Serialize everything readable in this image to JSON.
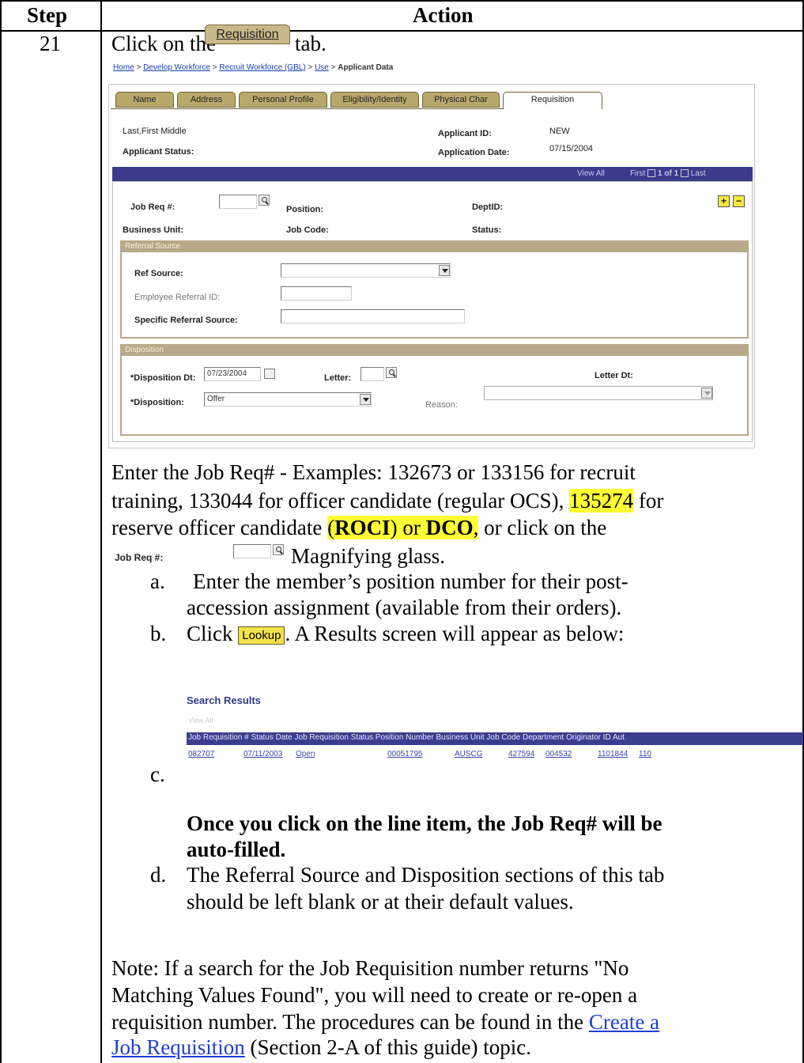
{
  "table": {
    "col_step": "Step",
    "col_action": "Action",
    "step_number": "21"
  },
  "intro": {
    "prefix": "Click on the",
    "tab_button": "Requisition",
    "suffix": "tab."
  },
  "screen": {
    "breadcrumb": [
      "Home",
      "Develop Workforce",
      "Recruit Workforce (GBL)",
      "Use",
      "Applicant Data"
    ],
    "tabs": [
      "Name",
      "Address",
      "Personal Profile",
      "Eligibility/Identity",
      "Physical Char",
      "Requisition"
    ],
    "name_line": "Last,First Middle",
    "applicant_status_label": "Applicant Status:",
    "applicant_id_label": "Applicant ID:",
    "applicant_id_value": "NEW",
    "application_date_label": "Application Date:",
    "application_date_value": "07/15/2004",
    "nav": {
      "view_all": "View All",
      "first": "First",
      "count": "1 of 1",
      "last": "Last"
    },
    "job_req_label": "Job Req #:",
    "position_label": "Position:",
    "deptid_label": "DeptID:",
    "business_unit_label": "Business Unit:",
    "job_code_label": "Job Code:",
    "status_label": "Status:",
    "referral": {
      "header": "Referral Source",
      "ref_source_label": "Ref Source:",
      "employee_referral_label": "Employee Referral ID:",
      "specific_referral_label": "Specific Referral Source:"
    },
    "disposition": {
      "header": "Disposition",
      "disposition_dt_label": "*Disposition Dt:",
      "disposition_dt_value": "07/23/2004",
      "letter_label": "Letter:",
      "letter_dt_label": "Letter Dt:",
      "disposition_label": "*Disposition:",
      "disposition_value": "Offer",
      "reason_label": "Reason:"
    }
  },
  "para1": {
    "line1": "Enter the Job Req# - Examples: 132673 or 133156 for recruit",
    "line2_a": "training, 133044 for officer candidate (regular OCS),",
    "line2_hl": "135274",
    "line2_b": "for",
    "line3_a": "reserve officer candidate",
    "line3_hl_open": "(",
    "line3_roci": "ROCI",
    "line3_hl_mid": ") or",
    "line3_dco": "DCO",
    "line3_hl_close": ",",
    "line3_b": "or click on the"
  },
  "jobreq_inline": {
    "label": "Job Req #:",
    "text": "Magnifying glass."
  },
  "steps": {
    "a_letter": "a.",
    "a_line1": "Enter the member’s position number for their post-",
    "a_line2": "accession assignment (available from their orders).",
    "b_letter": "b.",
    "b_prefix": "Click",
    "b_button": "Lookup",
    "b_suffix": ". A Results screen will appear as below:",
    "c_letter": "c.",
    "c_bold_line1": "Once you click on the line item, the Job Req# will be",
    "c_bold_line2": "auto-filled.",
    "d_letter": "d.",
    "d_line1": "The Referral Source and Disposition sections of this tab",
    "d_line2": "should be left blank or at their default values."
  },
  "results": {
    "title": "Search Results",
    "view_all": "View All",
    "columns": "Job Requisition # Status Date Job Requisition Status Position Number Business Unit Job Code Department Originator ID Aut",
    "row": [
      "082707",
      "07/11/2003",
      "Open",
      "00051795",
      "AUSCG",
      "427594",
      "004532",
      "1101844",
      "110"
    ]
  },
  "note": {
    "line1": "Note: If a search for the Job Requisition number returns \"No",
    "line2": "Matching Values Found\", you will need to create or re-open a",
    "line3_a": "requisition number. The procedures can be found in the",
    "line3_link": "Create a",
    "line4_link": "Job Requisition",
    "line4_b": " (Section 2-A of this guide) topic."
  }
}
